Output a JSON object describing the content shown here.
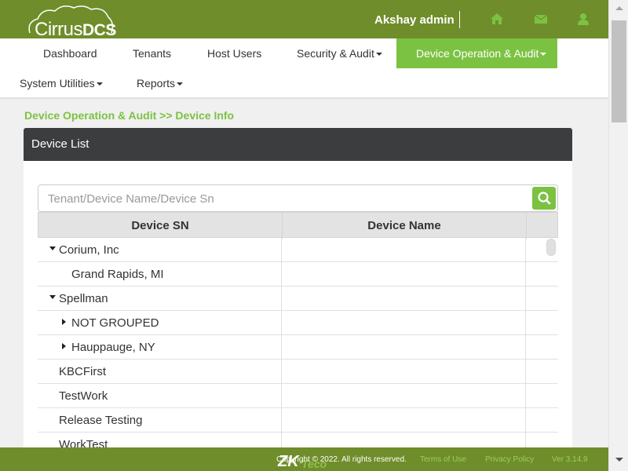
{
  "brand": {
    "logo_thin": "Cirrus",
    "logo_bold": "DCS"
  },
  "header": {
    "username": "Akshay admin",
    "icons": [
      "home-icon",
      "envelope-icon",
      "user-icon"
    ]
  },
  "nav": {
    "row1": [
      {
        "label": "Dashboard",
        "dropdown": false
      },
      {
        "label": "Tenants",
        "dropdown": false
      },
      {
        "label": "Host Users",
        "dropdown": false
      },
      {
        "label": "Security & Audit",
        "dropdown": true
      },
      {
        "label": "Device Operation & Audit",
        "dropdown": true,
        "active": true
      }
    ],
    "row2": [
      {
        "label": "System Utilities",
        "dropdown": true
      },
      {
        "label": "Reports",
        "dropdown": true
      }
    ]
  },
  "breadcrumb": "Device Operation & Audit >> Device Info",
  "panel": {
    "title": "Device List",
    "search": {
      "placeholder": "Tenant/Device Name/Device Sn",
      "value": ""
    },
    "columns": [
      "Device SN",
      "Device Name",
      ""
    ],
    "rows": [
      {
        "sn": "Corium, Inc",
        "name": "",
        "expander": "expanded"
      },
      {
        "sn": "Grand Rapids, MI",
        "name": "",
        "expander": "none"
      },
      {
        "sn": "Spellman",
        "name": "",
        "expander": "expanded"
      },
      {
        "sn": "NOT GROUPED",
        "name": "",
        "expander": "collapsed"
      },
      {
        "sn": "Hauppauge, NY",
        "name": "",
        "expander": "collapsed"
      },
      {
        "sn": "KBCFirst",
        "name": "",
        "expander": "none"
      },
      {
        "sn": "TestWork",
        "name": "",
        "expander": "none"
      },
      {
        "sn": "Release Testing",
        "name": "",
        "expander": "none"
      },
      {
        "sn": "WorkTest",
        "name": "",
        "expander": "none"
      }
    ]
  },
  "footer": {
    "copyright": "Copyright © 2022. All rights reserved.",
    "terms": "Terms of Use",
    "privacy": "Privacy Policy",
    "version": "Ver 3.14.9",
    "logo_text": "ZKTeco"
  },
  "colors": {
    "header_green": "#6f8d2a",
    "accent_green": "#7cc242",
    "panel_header": "#3c3d3e"
  }
}
